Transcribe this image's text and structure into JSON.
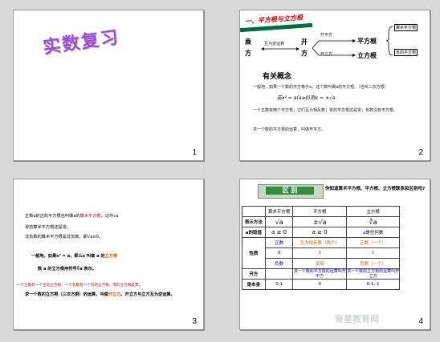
{
  "slide1": {
    "title": "实数复习",
    "number": "1"
  },
  "slide2": {
    "number": "2",
    "header": "一、平方根与立方根",
    "left_top": "乘",
    "left_bottom": "方",
    "inverse": "互为逆运算",
    "kai": "开",
    "fang": "方",
    "kai_pingfang": "开平方",
    "kai_lifang": "开立方",
    "pingfanggen": "平方根",
    "lifanggen": "立方根",
    "suanshu": "算术平方根",
    "fu": "负的平方根",
    "concept_title": "有关概念",
    "line1": "一般地，如果一个数的平方等于a，这个数叫做a的平方根。",
    "line1b": "（也叫二次方根）",
    "formula": "若x² = a(a≥0)则x = ±√a",
    "line2": "一个正数有两个平方根，它们互为相反数；零的平方根还是零，负数没有平方根。",
    "line3": "求一个数的平方根的运算，叫做开平方。"
  },
  "slide3": {
    "number": "3",
    "p1a": "正数a的正的平方根也叫做a的",
    "p1b": "算术平方根",
    "p1c": "，记作√a",
    "p2": "零的算术平方根还是零。",
    "p3": "非负数的算术平方根是非负数，即√a≥0。",
    "cube_a": "一般地，如果x³ = a，那么x 叫做 a 的",
    "cube_b": "立方根",
    "cube_c": "数 a 的立方根用符号∛a 表示。",
    "redline": "一个正数有一个正的立方根，一个负数有一个负的立方根，零的立方根是零。",
    "last_a": "求一个数的立方根（三次方根）的运算，叫做",
    "last_b": "开立方",
    "last_c": "。开立方与立方互为逆运算。"
  },
  "slide4": {
    "number": "4",
    "banner": "区 别",
    "question": "你知道算术平方根、平方根、立方根联系和区别吗?",
    "headers": [
      "",
      "算术平方根",
      "平方根",
      "立方根"
    ],
    "rows": [
      {
        "label": "表示方法",
        "cells": [
          "√a",
          "±√a",
          "∛a"
        ]
      },
      {
        "label": "a的取值",
        "cells": [
          "a ≥ 0",
          "a ≥ 0",
          "a是任何数"
        ]
      },
      {
        "label": "正数",
        "cells": [
          "正数（一个）",
          "互为相反数（两个）",
          "正数（一个）"
        ]
      },
      {
        "label": "0",
        "cells": [
          "0",
          "0",
          "0"
        ]
      },
      {
        "label": "负数",
        "cells": [
          "没有",
          "没有",
          "负数（一个）"
        ]
      },
      {
        "label": "开方",
        "cells": [
          "",
          "求一个数的平方根的运算叫开平方",
          "求一个数的立方根的运算叫开立方"
        ]
      },
      {
        "label": "是本身",
        "cells": [
          "0,1",
          "0",
          "0,1,-1"
        ]
      }
    ],
    "xingzhi": "性质",
    "watermark": "育星教育网"
  }
}
